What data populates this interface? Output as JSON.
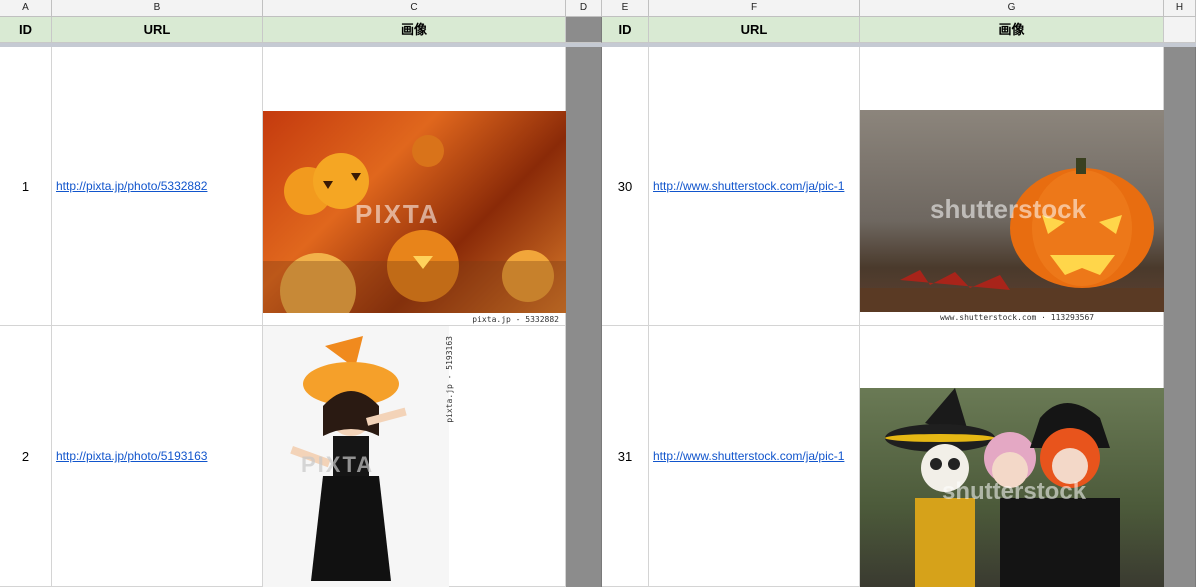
{
  "columns": [
    "A",
    "B",
    "C",
    "D",
    "E",
    "F",
    "G",
    "H"
  ],
  "headers": {
    "left_id": "ID",
    "left_url": "URL",
    "left_image": "画像",
    "right_id": "ID",
    "right_url": "URL",
    "right_image": "画像"
  },
  "rows": [
    {
      "left": {
        "id": "1",
        "url": "http://pixta.jp/photo/5332882",
        "caption": "pixta.jp - 5332882",
        "watermark": "PIXTA"
      },
      "right": {
        "id": "30",
        "url": "http://www.shutterstock.com/ja/pic-1",
        "caption": "www.shutterstock.com · 113293567",
        "watermark": "shutterstock"
      }
    },
    {
      "left": {
        "id": "2",
        "url": "http://pixta.jp/photo/5193163",
        "caption": "pixta.jp - 5193163",
        "watermark": "PIXTA"
      },
      "right": {
        "id": "31",
        "url": "http://www.shutterstock.com/ja/pic-1",
        "watermark": "shutterstock"
      }
    }
  ],
  "colors": {
    "header_green": "#d9ead3",
    "link": "#1155cc",
    "divider_gray": "#8c8c8c"
  }
}
